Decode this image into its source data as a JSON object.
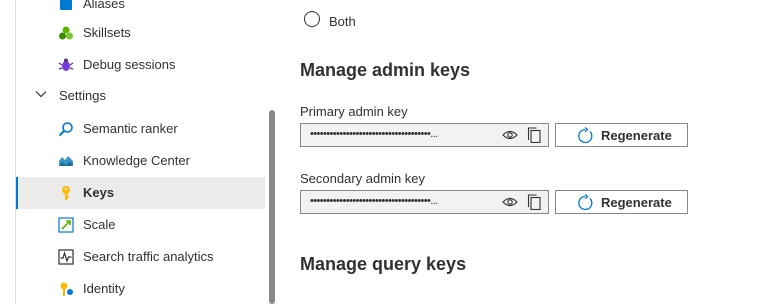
{
  "sidebar": {
    "items_top": [
      {
        "label": "Aliases",
        "icon": "aliases-icon"
      },
      {
        "label": "Skillsets",
        "icon": "skillsets-icon"
      },
      {
        "label": "Debug sessions",
        "icon": "debug-icon"
      }
    ],
    "group": {
      "label": "Settings",
      "icon": "chevron-down-icon"
    },
    "items": [
      {
        "label": "Semantic ranker",
        "icon": "semantic-ranker-icon"
      },
      {
        "label": "Knowledge Center",
        "icon": "knowledge-center-icon"
      },
      {
        "label": "Keys",
        "icon": "key-icon",
        "selected": true
      },
      {
        "label": "Scale",
        "icon": "scale-icon"
      },
      {
        "label": "Search traffic analytics",
        "icon": "analytics-icon"
      },
      {
        "label": "Identity",
        "icon": "identity-icon"
      }
    ]
  },
  "main": {
    "radio_both_label": "Both",
    "admin_title": "Manage admin keys",
    "primary_label": "Primary admin key",
    "primary_value": "•••••••••••••••••••••••••••••••••••••...",
    "secondary_label": "Secondary admin key",
    "secondary_value": "•••••••••••••••••••••••••••••••••••••...",
    "regenerate_label": "Regenerate",
    "query_title": "Manage query keys"
  },
  "colors": {
    "accent": "#0078d4",
    "selected_bg": "#edebe9",
    "field_bg": "#f3f2f1"
  }
}
